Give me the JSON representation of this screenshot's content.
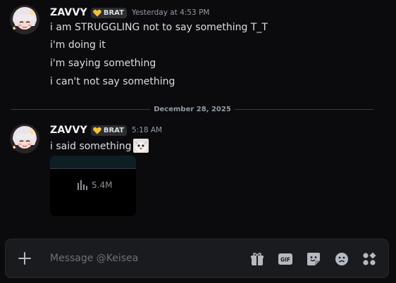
{
  "messages": [
    {
      "username": "ZAVVY",
      "tag": "BRAT",
      "timestamp": "Yesterday at 4:53 PM",
      "lines": [
        "i am STRUGGLING not to say something T_T",
        "i'm doing it",
        "i'm saying something",
        "i can't not say something"
      ]
    },
    {
      "username": "ZAVVY",
      "tag": "BRAT",
      "timestamp": "5:18 AM",
      "lines": [
        "i said something"
      ],
      "embed": {
        "stat_icon": "bar-chart-icon",
        "stat_value": "5.4M"
      }
    }
  ],
  "date_divider": "December 28, 2025",
  "composer": {
    "placeholder": "Message @Keisea",
    "buttons": [
      "gift-icon",
      "gif-icon",
      "sticker-icon",
      "emoji-icon",
      "apps-icon"
    ]
  },
  "colors": {
    "background": "#0b0b0d",
    "username": "#f2f3f5",
    "text": "#dbdee1",
    "muted": "#949ba4",
    "tag_bg": "#2b2d31",
    "tag_badge": "#f0c33c"
  }
}
